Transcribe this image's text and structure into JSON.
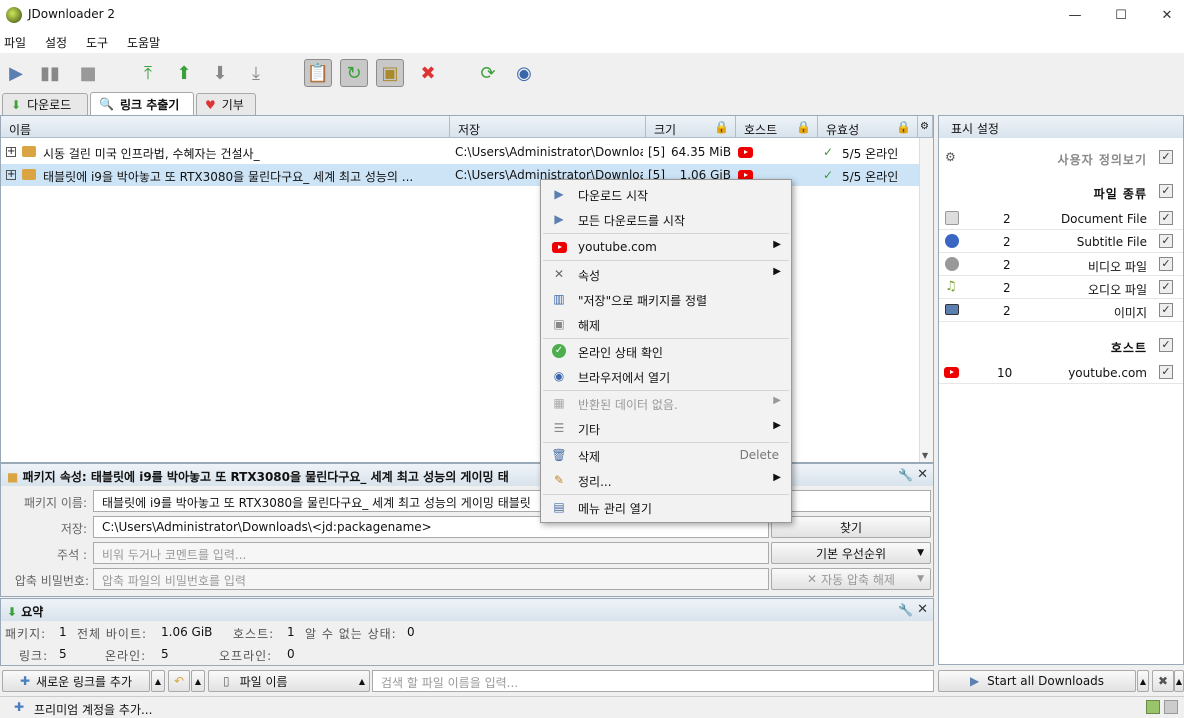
{
  "window": {
    "title": "JDownloader 2",
    "minimize": "—",
    "maximize": "☐",
    "close": "✕"
  },
  "menu": [
    "파일",
    "설정",
    "도구",
    "도움말"
  ],
  "tabs": [
    {
      "label": "다운로드"
    },
    {
      "label": "링크 추출기"
    },
    {
      "label": "기부"
    }
  ],
  "columns": {
    "name": "이름",
    "save": "저장",
    "size": "크기",
    "host": "호스트",
    "validity": "유효성"
  },
  "packages": [
    {
      "expander": "+",
      "name": "시동 걸린 미국 인프라법, 수혜자는 건설사_",
      "path": "C:\\Users\\Administrator\\Downloa...",
      "count": "[5]",
      "size": "64.35 MiB",
      "status": "5/5 온라인"
    },
    {
      "expander": "+",
      "name": "태블릿에 i9을 박아놓고 또 RTX3080을 물린다구요_ 세계 최고 성능의 ...",
      "path": "C:\\Users\\Administrator\\Downloa...",
      "count": "[5]",
      "size": "1.06 GiB",
      "status": "5/5 온라인"
    }
  ],
  "right_panel": {
    "title": "표시 설정",
    "custom_view": "사용자 정의보기",
    "file_types_header": "파일 종류",
    "file_types": [
      {
        "count": "2",
        "label": "Document File"
      },
      {
        "count": "2",
        "label": "Subtitle File"
      },
      {
        "count": "2",
        "label": "비디오 파일"
      },
      {
        "count": "2",
        "label": "오디오 파일"
      },
      {
        "count": "2",
        "label": "이미지"
      }
    ],
    "hosts_header": "호스트",
    "hosts": [
      {
        "count": "10",
        "label": "youtube.com"
      }
    ],
    "check": "✓"
  },
  "package_props": {
    "header": "패키지 속성: 태블릿에 i9를 박아놓고 또 RTX3080을 물린다구요_ 세계 최고 성능의 게이밍 태",
    "name_label": "패키지 이름:",
    "name_value": "태블릿에 i9를 박아놓고 또 RTX3080을 물린다구요_ 세계 최고 성능의 게이밍 태블릿",
    "save_label": "저장:",
    "save_value": "C:\\Users\\Administrator\\Downloads\\<jd:packagename>",
    "browse": "찾기",
    "comment_label": "주석 :",
    "comment_placeholder": "비워 두거나 코멘트를 입력...",
    "priority": "기본 우선순위",
    "password_label": "압축 비밀번호:",
    "password_placeholder": "압축 파일의 비밀번호를 입력",
    "extract": "자동 압축 해제"
  },
  "summary": {
    "header": "요약",
    "packages_label": "패키지:",
    "packages": "1",
    "bytes_label": "전체 바이트:",
    "bytes": "1.06 GiB",
    "hosts_label": "호스트:",
    "hosts": "1",
    "unknown_label": "알 수 없는 상태:",
    "unknown": "0",
    "links_label": "링크:",
    "links": "5",
    "online_label": "온라인:",
    "online": "5",
    "offline_label": "오프라인:",
    "offline": "0"
  },
  "bottom": {
    "add_links": "새로운 링크를 추가",
    "filename_sort": "파일 이름",
    "search_placeholder": "검색 할 파일 이름을 입력...",
    "start_all": "Start all Downloads",
    "premium": "프리미엄 계정을 추가..."
  },
  "context_menu": [
    {
      "label": "다운로드 시작",
      "icon": "start-download-icon"
    },
    {
      "label": "모든 다운로드를 시작",
      "icon": "start-all-icon"
    },
    {
      "label": "youtube.com",
      "icon": "youtube-icon",
      "submenu": true
    },
    {
      "label": "속성",
      "icon": "properties-icon",
      "submenu": true
    },
    {
      "label": "\"저장\"으로 패키지를 정렬",
      "icon": "sort-icon"
    },
    {
      "label": "해제",
      "icon": "ungroup-icon"
    },
    {
      "label": "온라인 상태 확인",
      "icon": "check-online-icon"
    },
    {
      "label": "브라우저에서 열기",
      "icon": "browser-icon"
    },
    {
      "label": "반환된 데이터 없음.",
      "icon": "no-data-icon",
      "submenu": true,
      "disabled": true
    },
    {
      "label": "기타",
      "icon": "other-icon",
      "submenu": true
    },
    {
      "label": "삭제",
      "icon": "delete-icon",
      "shortcut": "Delete"
    },
    {
      "label": "정리...",
      "icon": "cleanup-icon",
      "submenu": true
    },
    {
      "label": "메뉴 관리 열기",
      "icon": "menu-manager-icon"
    }
  ],
  "colors": {
    "selection": "#cde4f7",
    "accent": "#2a8a2a",
    "youtube": "#ee0000"
  }
}
